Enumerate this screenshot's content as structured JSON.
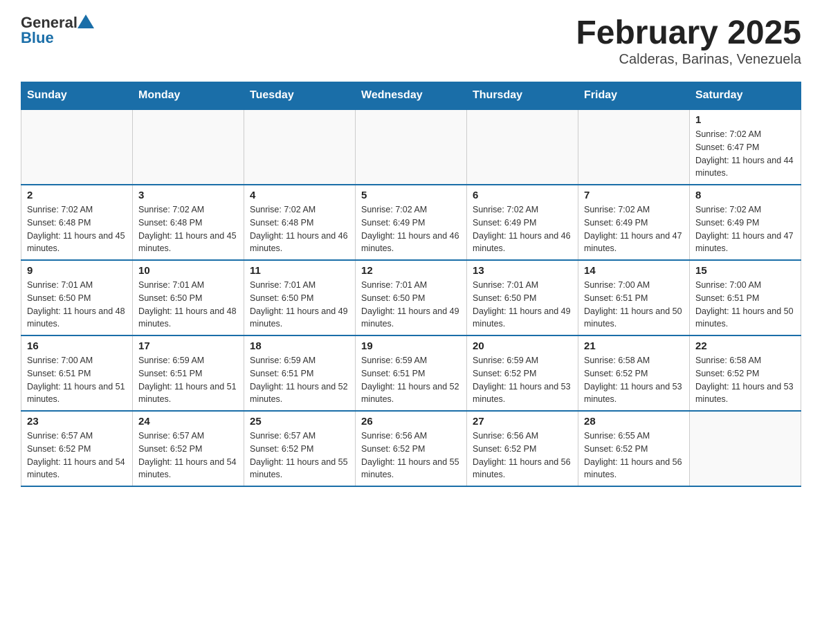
{
  "header": {
    "logo_general": "General",
    "logo_blue": "Blue",
    "month_title": "February 2025",
    "location": "Calderas, Barinas, Venezuela"
  },
  "days_of_week": [
    "Sunday",
    "Monday",
    "Tuesday",
    "Wednesday",
    "Thursday",
    "Friday",
    "Saturday"
  ],
  "weeks": [
    [
      {
        "day": "",
        "info": ""
      },
      {
        "day": "",
        "info": ""
      },
      {
        "day": "",
        "info": ""
      },
      {
        "day": "",
        "info": ""
      },
      {
        "day": "",
        "info": ""
      },
      {
        "day": "",
        "info": ""
      },
      {
        "day": "1",
        "info": "Sunrise: 7:02 AM\nSunset: 6:47 PM\nDaylight: 11 hours and 44 minutes."
      }
    ],
    [
      {
        "day": "2",
        "info": "Sunrise: 7:02 AM\nSunset: 6:48 PM\nDaylight: 11 hours and 45 minutes."
      },
      {
        "day": "3",
        "info": "Sunrise: 7:02 AM\nSunset: 6:48 PM\nDaylight: 11 hours and 45 minutes."
      },
      {
        "day": "4",
        "info": "Sunrise: 7:02 AM\nSunset: 6:48 PM\nDaylight: 11 hours and 46 minutes."
      },
      {
        "day": "5",
        "info": "Sunrise: 7:02 AM\nSunset: 6:49 PM\nDaylight: 11 hours and 46 minutes."
      },
      {
        "day": "6",
        "info": "Sunrise: 7:02 AM\nSunset: 6:49 PM\nDaylight: 11 hours and 46 minutes."
      },
      {
        "day": "7",
        "info": "Sunrise: 7:02 AM\nSunset: 6:49 PM\nDaylight: 11 hours and 47 minutes."
      },
      {
        "day": "8",
        "info": "Sunrise: 7:02 AM\nSunset: 6:49 PM\nDaylight: 11 hours and 47 minutes."
      }
    ],
    [
      {
        "day": "9",
        "info": "Sunrise: 7:01 AM\nSunset: 6:50 PM\nDaylight: 11 hours and 48 minutes."
      },
      {
        "day": "10",
        "info": "Sunrise: 7:01 AM\nSunset: 6:50 PM\nDaylight: 11 hours and 48 minutes."
      },
      {
        "day": "11",
        "info": "Sunrise: 7:01 AM\nSunset: 6:50 PM\nDaylight: 11 hours and 49 minutes."
      },
      {
        "day": "12",
        "info": "Sunrise: 7:01 AM\nSunset: 6:50 PM\nDaylight: 11 hours and 49 minutes."
      },
      {
        "day": "13",
        "info": "Sunrise: 7:01 AM\nSunset: 6:50 PM\nDaylight: 11 hours and 49 minutes."
      },
      {
        "day": "14",
        "info": "Sunrise: 7:00 AM\nSunset: 6:51 PM\nDaylight: 11 hours and 50 minutes."
      },
      {
        "day": "15",
        "info": "Sunrise: 7:00 AM\nSunset: 6:51 PM\nDaylight: 11 hours and 50 minutes."
      }
    ],
    [
      {
        "day": "16",
        "info": "Sunrise: 7:00 AM\nSunset: 6:51 PM\nDaylight: 11 hours and 51 minutes."
      },
      {
        "day": "17",
        "info": "Sunrise: 6:59 AM\nSunset: 6:51 PM\nDaylight: 11 hours and 51 minutes."
      },
      {
        "day": "18",
        "info": "Sunrise: 6:59 AM\nSunset: 6:51 PM\nDaylight: 11 hours and 52 minutes."
      },
      {
        "day": "19",
        "info": "Sunrise: 6:59 AM\nSunset: 6:51 PM\nDaylight: 11 hours and 52 minutes."
      },
      {
        "day": "20",
        "info": "Sunrise: 6:59 AM\nSunset: 6:52 PM\nDaylight: 11 hours and 53 minutes."
      },
      {
        "day": "21",
        "info": "Sunrise: 6:58 AM\nSunset: 6:52 PM\nDaylight: 11 hours and 53 minutes."
      },
      {
        "day": "22",
        "info": "Sunrise: 6:58 AM\nSunset: 6:52 PM\nDaylight: 11 hours and 53 minutes."
      }
    ],
    [
      {
        "day": "23",
        "info": "Sunrise: 6:57 AM\nSunset: 6:52 PM\nDaylight: 11 hours and 54 minutes."
      },
      {
        "day": "24",
        "info": "Sunrise: 6:57 AM\nSunset: 6:52 PM\nDaylight: 11 hours and 54 minutes."
      },
      {
        "day": "25",
        "info": "Sunrise: 6:57 AM\nSunset: 6:52 PM\nDaylight: 11 hours and 55 minutes."
      },
      {
        "day": "26",
        "info": "Sunrise: 6:56 AM\nSunset: 6:52 PM\nDaylight: 11 hours and 55 minutes."
      },
      {
        "day": "27",
        "info": "Sunrise: 6:56 AM\nSunset: 6:52 PM\nDaylight: 11 hours and 56 minutes."
      },
      {
        "day": "28",
        "info": "Sunrise: 6:55 AM\nSunset: 6:52 PM\nDaylight: 11 hours and 56 minutes."
      },
      {
        "day": "",
        "info": ""
      }
    ]
  ]
}
